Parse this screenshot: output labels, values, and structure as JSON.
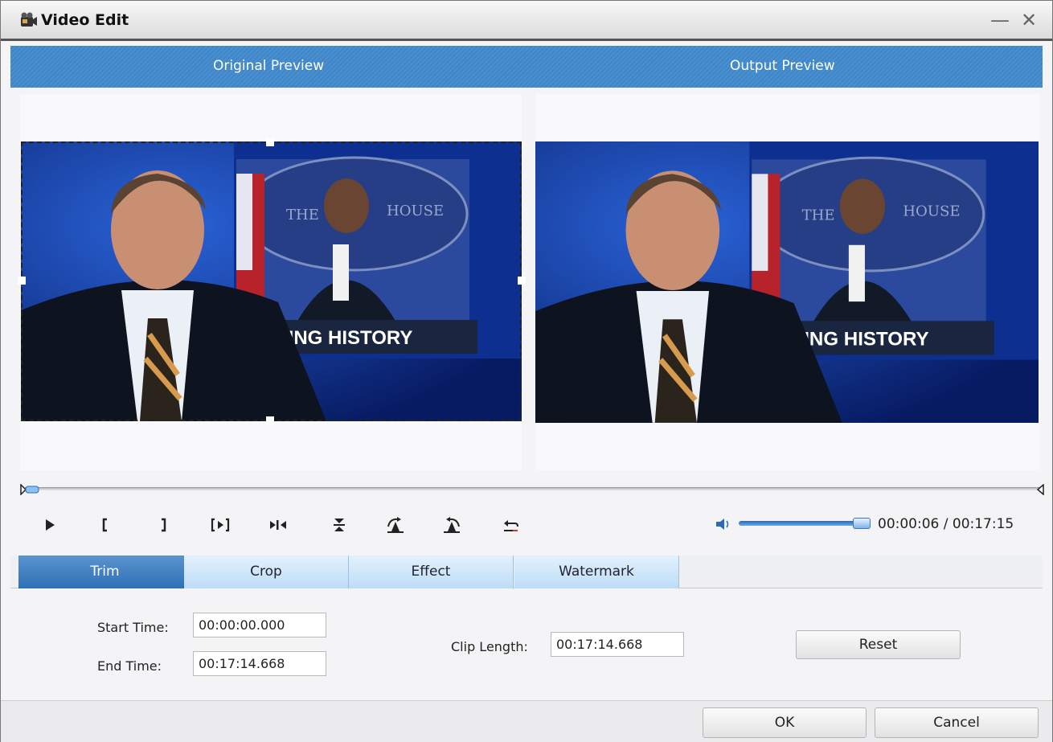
{
  "window": {
    "title": "Video Edit",
    "minimize_icon": "minimize-icon",
    "close_icon": "close-icon"
  },
  "preview": {
    "original_label": "Original Preview",
    "output_label": "Output Preview"
  },
  "video_frame": {
    "caption": "MAKING HISTORY",
    "backdrop_text_left": "THE",
    "backdrop_text_right": "HOUSE"
  },
  "playback": {
    "current_time": "00:00:06",
    "total_time": "00:17:15",
    "time_display": "00:00:06 / 00:17:15",
    "volume_level": 0.95,
    "controls": [
      "play-icon",
      "mark-in-icon",
      "mark-out-icon",
      "play-selection-icon",
      "step-icon",
      "flip-vertical-icon",
      "rotate-right-icon",
      "rotate-left-icon",
      "undo-icon"
    ]
  },
  "tabs": [
    {
      "label": "Trim",
      "active": true
    },
    {
      "label": "Crop",
      "active": false
    },
    {
      "label": "Effect",
      "active": false
    },
    {
      "label": "Watermark",
      "active": false
    }
  ],
  "trim": {
    "start_label": "Start Time:",
    "start_value": "00:00:00.000",
    "end_label": "End Time:",
    "end_value": "00:17:14.668",
    "clip_length_label": "Clip Length:",
    "clip_length_value": "00:17:14.668",
    "reset_label": "Reset"
  },
  "footer": {
    "ok_label": "OK",
    "cancel_label": "Cancel"
  },
  "colors": {
    "header_blue": "#4a8fce",
    "tab_active": "#2f6fb5",
    "tab_inactive": "#cfe6f9",
    "video_blue": "#0b2a8c"
  }
}
